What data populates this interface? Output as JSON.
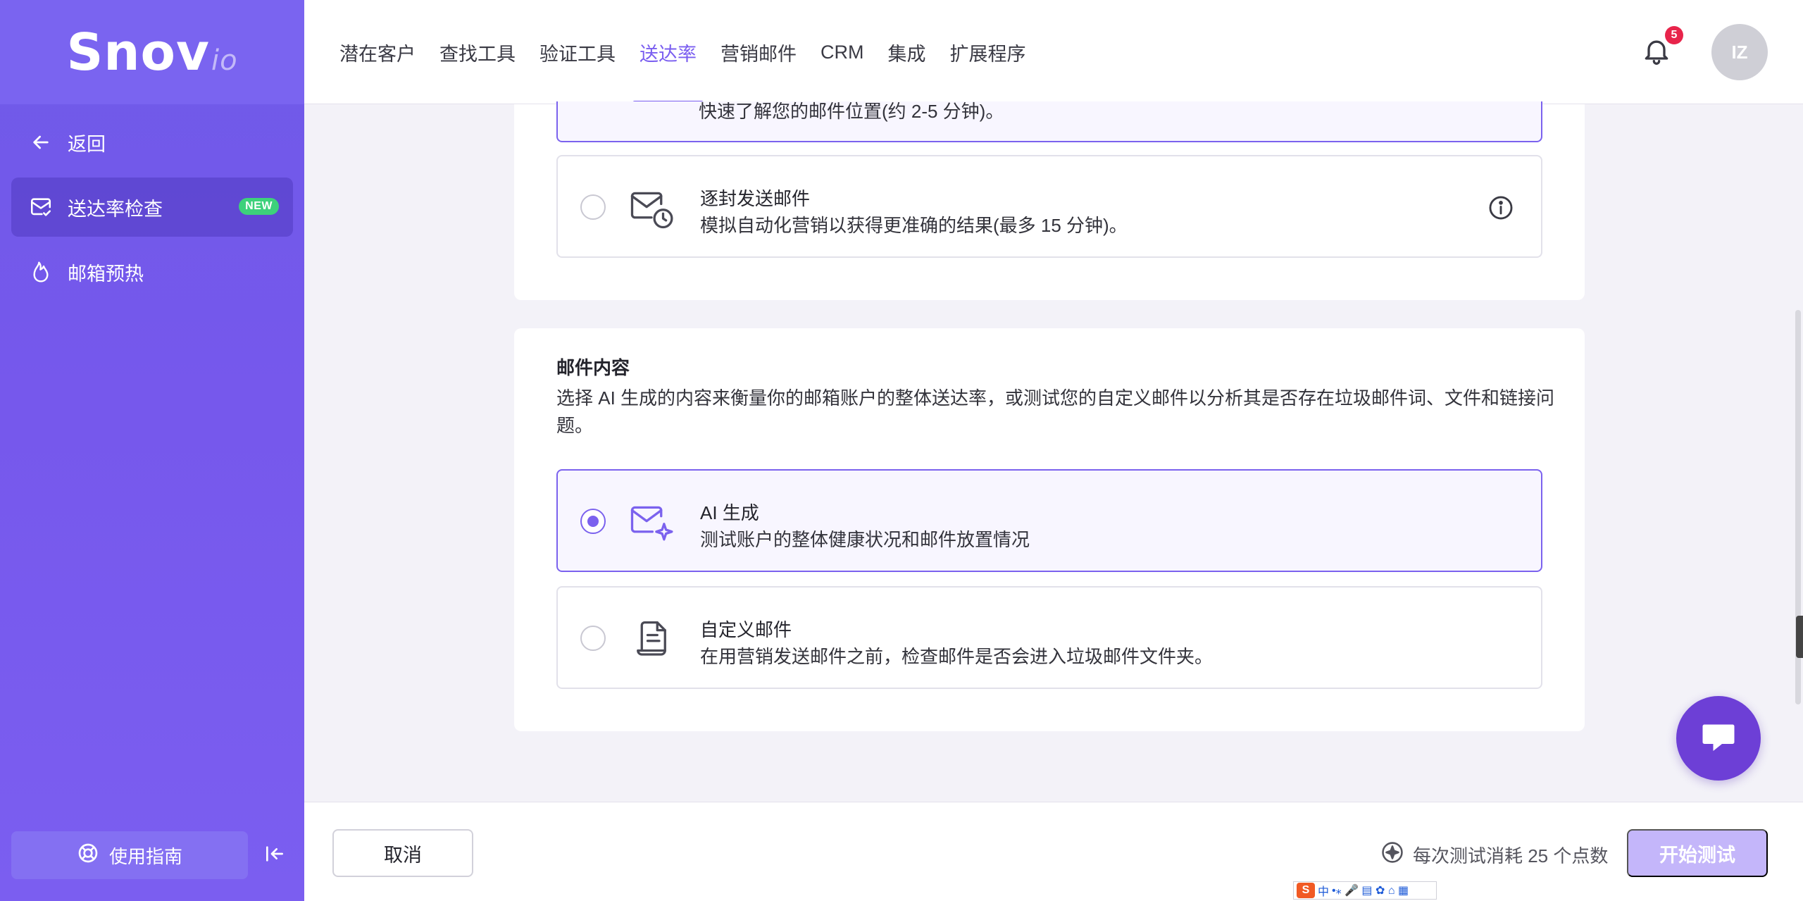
{
  "app": {
    "logo_main": "Snov",
    "logo_suffix": "io"
  },
  "sidebar": {
    "back_label": "返回",
    "items": [
      {
        "label": "送达率检查",
        "badge": "NEW",
        "active": true
      },
      {
        "label": "邮箱预热",
        "active": false
      }
    ],
    "guide_label": "使用指南"
  },
  "nav": {
    "items": [
      "潜在客户",
      "查找工具",
      "验证工具",
      "送达率",
      "营销邮件",
      "CRM",
      "集成",
      "扩展程序"
    ],
    "active": "送达率",
    "notification_count": "5",
    "avatar_initials": "IZ"
  },
  "sending_method": {
    "partial_option_desc": "快速了解您的邮件位置(约 2-5 分钟)。",
    "one_by_one": {
      "title": "逐封发送邮件",
      "desc": "模拟自动化营销以获得更准确的结果(最多 15 分钟)。"
    }
  },
  "email_content": {
    "title": "邮件内容",
    "desc": "选择 AI 生成的内容来衡量你的邮箱账户的整体送达率，或测试您的自定义邮件以分析其是否存在垃圾邮件词、文件和链接问题。",
    "options": [
      {
        "title": "AI 生成",
        "desc": "测试账户的整体健康状况和邮件放置情况",
        "selected": true
      },
      {
        "title": "自定义邮件",
        "desc": "在用营销发送邮件之前，检查邮件是否会进入垃圾邮件文件夹。",
        "selected": false
      }
    ]
  },
  "footer": {
    "cancel_label": "取消",
    "cost_label": "每次测试消耗 25 个点数",
    "start_label": "开始测试"
  },
  "ime": {
    "logo": "S",
    "label": "中"
  },
  "colors": {
    "accent": "#7b62ee",
    "sidebar": "#7658ec",
    "new_badge": "#3dd17b",
    "chat": "#6d3fd6"
  }
}
